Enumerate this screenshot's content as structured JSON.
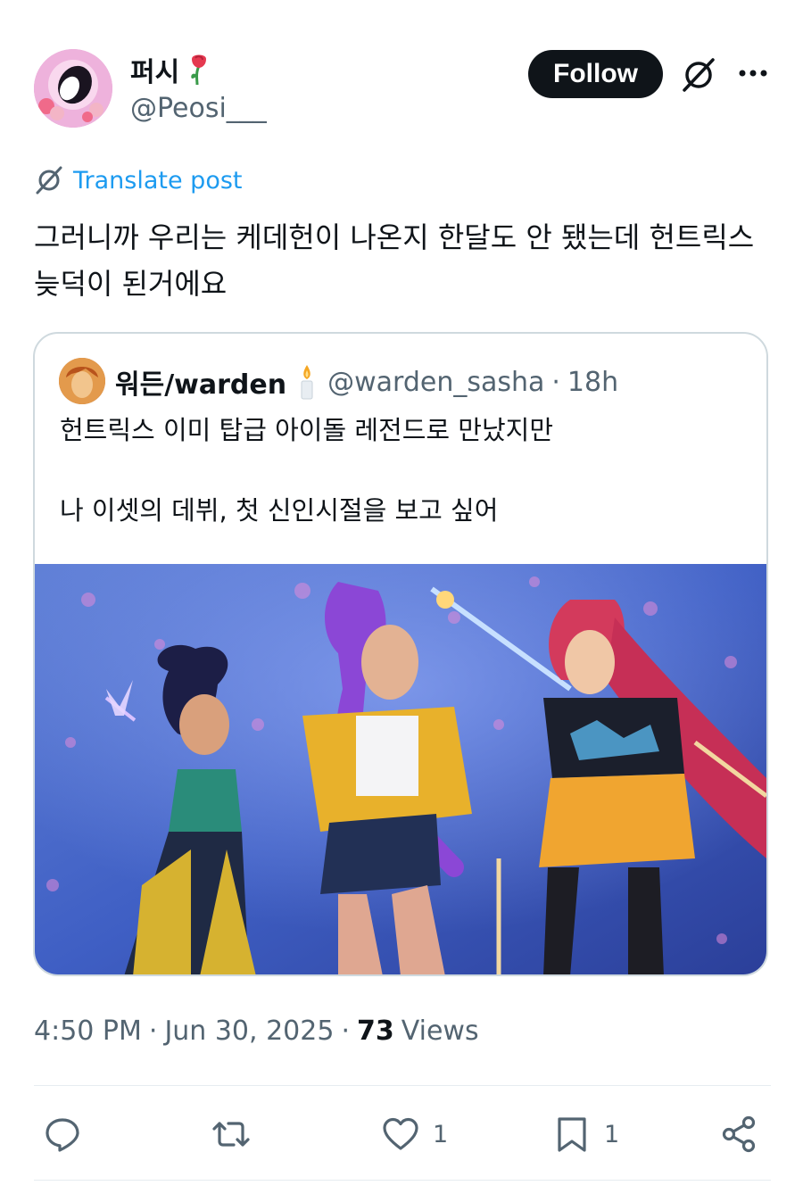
{
  "author": {
    "display_name": "퍼시",
    "handle": "@Peosi___"
  },
  "header": {
    "follow_label": "Follow"
  },
  "translate": {
    "label": "Translate post"
  },
  "post": {
    "text": "그러니까 우리는 케데헌이 나온지 한달도 안 됐는데 헌트릭스 늦덕이 된거에요"
  },
  "quote": {
    "display_name": "워든/warden",
    "handle": "@warden_sasha",
    "separator": "·",
    "time": "18h",
    "text": "헌트릭스 이미 탑급 아이돌 레전드로 만났지만\n\n나 이셋의 데뷔, 첫 신인시절을 보고 싶어"
  },
  "meta": {
    "time": "4:50 PM",
    "dot1": "·",
    "date": "Jun 30, 2025",
    "dot2": "·",
    "views_count": "73",
    "views_label": "Views"
  },
  "actions": {
    "reply_count": "",
    "repost_count": "",
    "like_count": "1",
    "bookmark_count": "1"
  },
  "colors": {
    "accent": "#1d9bf0",
    "text_primary": "#0f1419",
    "text_secondary": "#536471",
    "border": "#cfd9de",
    "follow_bg": "#0f1419"
  }
}
